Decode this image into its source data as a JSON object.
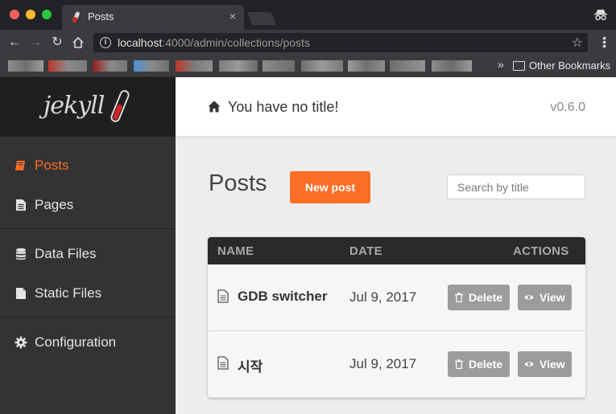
{
  "browser": {
    "tab_title": "Posts",
    "tab_close": "×",
    "url_host": "localhost",
    "url_path": ":4000/admin/collections/posts",
    "more_bookmarks": "»",
    "other_bookmarks": "Other Bookmarks"
  },
  "sidebar": {
    "logo_text": "jekyll",
    "items": [
      {
        "label": "Posts",
        "active": true
      },
      {
        "label": "Pages"
      },
      {
        "label": "Data Files"
      },
      {
        "label": "Static Files"
      },
      {
        "label": "Configuration"
      }
    ]
  },
  "header": {
    "site_title": "You have no title!",
    "version": "v0.6.0"
  },
  "main": {
    "title": "Posts",
    "new_post_label": "New post",
    "search_placeholder": "Search by title"
  },
  "table": {
    "columns": [
      "NAME",
      "DATE",
      "ACTIONS"
    ],
    "rows": [
      {
        "title": "GDB switcher",
        "date": "Jul 9, 2017"
      },
      {
        "title": "시작",
        "date": "Jul 9, 2017"
      }
    ],
    "delete_label": "Delete",
    "view_label": "View"
  },
  "colors": {
    "accent": "#fc6d26",
    "sidebar_bg": "#333333",
    "table_header_bg": "#2a2a2a",
    "action_button_bg": "#9c9c9c"
  }
}
